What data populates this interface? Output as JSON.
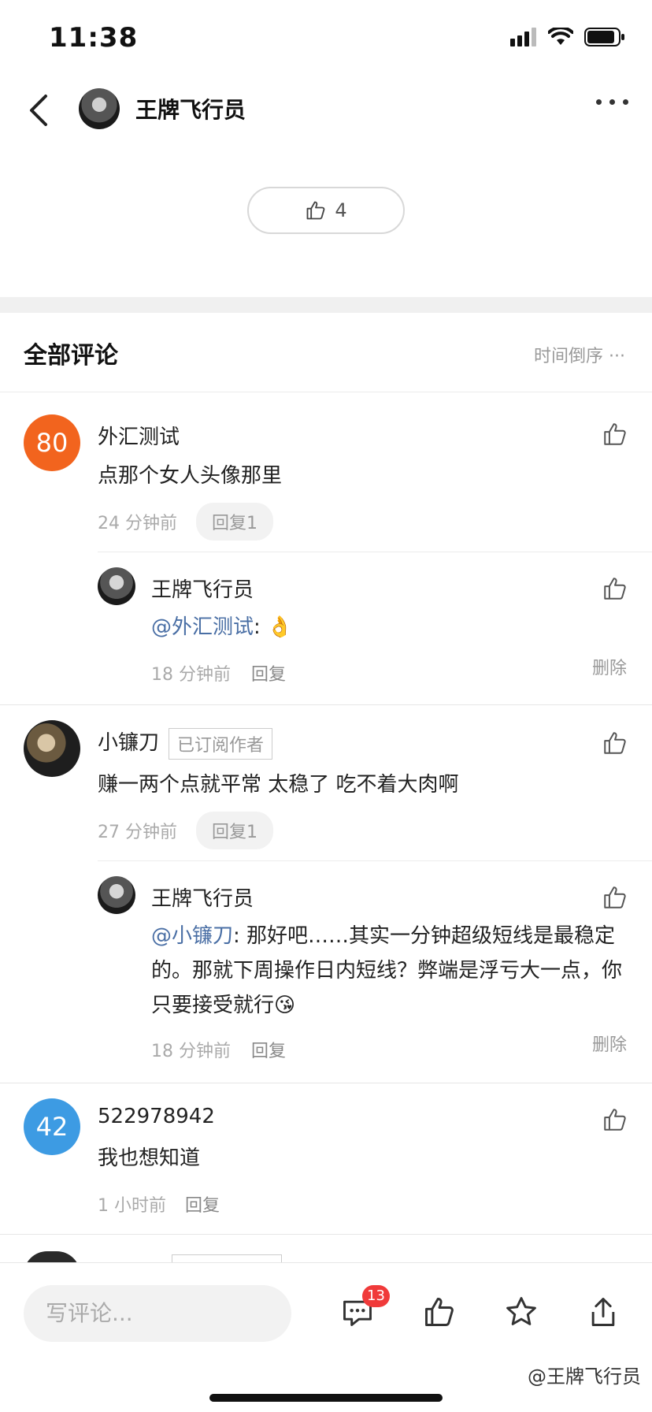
{
  "status_bar": {
    "time": "11:38"
  },
  "nav": {
    "title": "王牌飞行员"
  },
  "like": {
    "count": "4"
  },
  "section": {
    "title": "全部评论",
    "sort": "时间倒序 ···"
  },
  "comments": [
    {
      "avatar_text": "80",
      "avatar_color": "#f2641e",
      "name": "外汇测试",
      "text": "点那个女人头像那里",
      "time": "24 分钟前",
      "reply_label": "回复1",
      "replies": [
        {
          "name": "王牌飞行员",
          "mention": "@外汇测试",
          "text": ": 👌",
          "time": "18 分钟前",
          "reply_label": "回复",
          "delete_label": "删除"
        }
      ]
    },
    {
      "name": "小镰刀",
      "badge": "已订阅作者",
      "text": "赚一两个点就平常 太稳了 吃不着大肉啊",
      "time": "27 分钟前",
      "reply_label": "回复1",
      "replies": [
        {
          "name": "王牌飞行员",
          "mention": "@小镰刀",
          "text": ": 那好吧……其实一分钟超级短线是最稳定的。那就下周操作日内短线？弊端是浮亏大一点，你只要接受就行😘",
          "time": "18 分钟前",
          "reply_label": "回复",
          "delete_label": "删除"
        }
      ]
    },
    {
      "avatar_text": "42",
      "avatar_color": "#3d9be3",
      "name": "522978942",
      "text": "我也想知道",
      "time": "1 小时前",
      "reply_label": "回复"
    }
  ],
  "bottom": {
    "input_placeholder": "写评论...",
    "comment_badge": "13",
    "watermark": "@王牌飞行员"
  },
  "icons": [
    "back-icon",
    "more-icon",
    "thumb-up-icon",
    "comment-icon",
    "star-icon",
    "share-icon",
    "signal-icon",
    "wifi-icon",
    "battery-icon"
  ]
}
